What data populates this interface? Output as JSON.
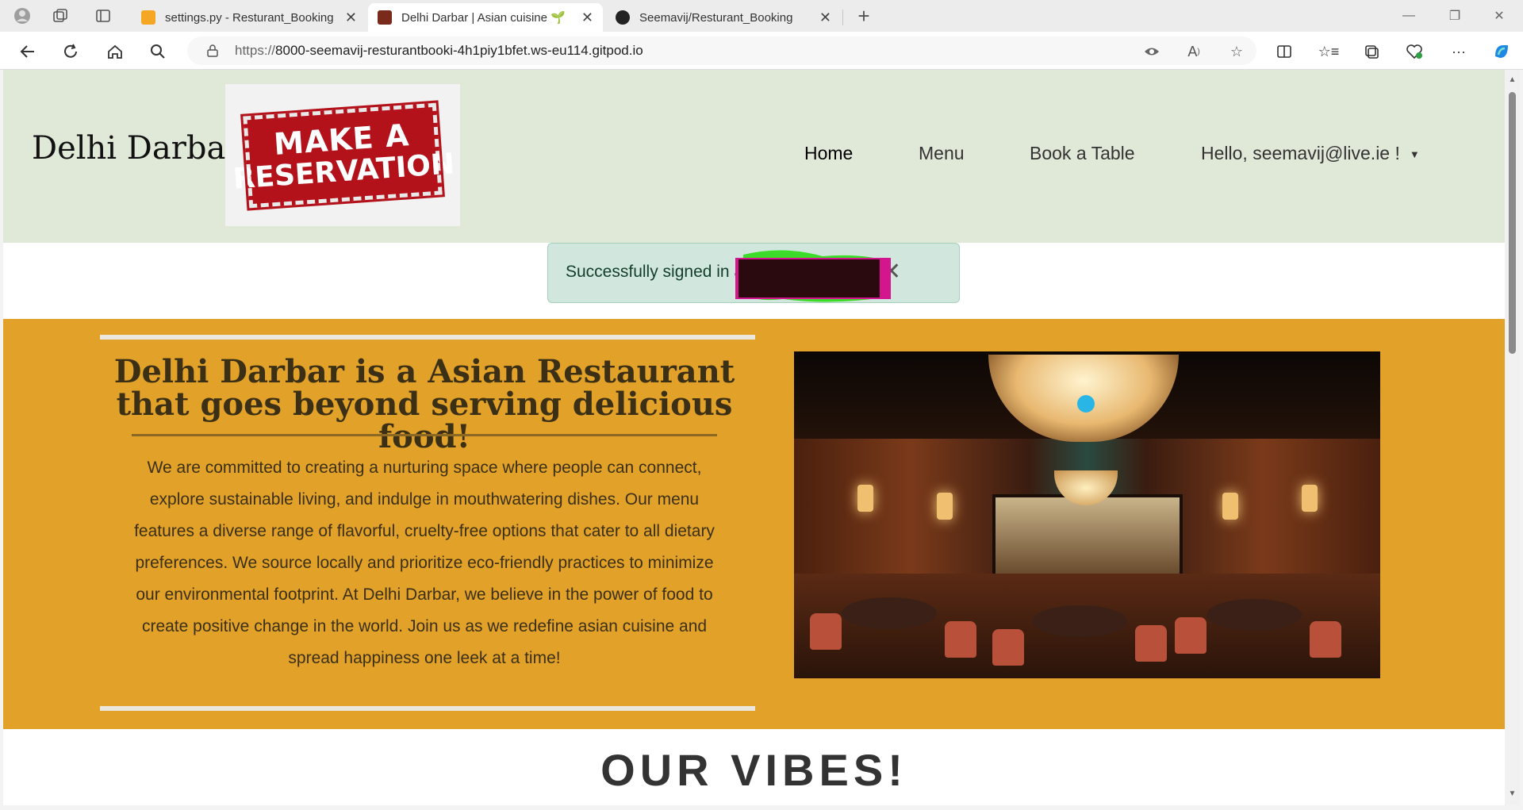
{
  "browser": {
    "tabs": [
      {
        "label": "settings.py - Resturant_Booking",
        "favicon_color": "#f5a623"
      },
      {
        "label": "Delhi Darbar | Asian cuisine 🌱",
        "favicon_color": "#7a2a1a"
      },
      {
        "label": "Seemavij/Resturant_Booking",
        "favicon_color": "#222222"
      }
    ],
    "url": {
      "scheme": "https://",
      "rest": "8000-seemavij-resturantbooki-4h1piy1bfet.ws-eu114.gitpod.io"
    }
  },
  "header": {
    "brand": "Delhi Darbar",
    "logo_lines": [
      "MAKE A",
      "RESERVATION"
    ],
    "nav": {
      "home": "Home",
      "menu": "Menu",
      "book": "Book a Table",
      "account": "Hello, seemavij@live.ie !"
    }
  },
  "alert": {
    "message": "Successfully signed in a",
    "close": "✕"
  },
  "about": {
    "title": "Delhi Darbar is a Asian Restaurant that goes beyond serving delicious food!",
    "body": "We are committed to creating a nurturing space where people can connect, explore sustainable living, and indulge in mouthwatering dishes. Our menu features a diverse range of flavorful, cruelty-free options that cater to all dietary preferences. We source locally and prioritize eco-friendly practices to minimize our environmental footprint. At Delhi Darbar, we believe in the power of food to create positive change in the world. Join us as we redefine asian cuisine and spread happiness one leek at a time!"
  },
  "vibes": {
    "heading": "OUR VIBES!"
  },
  "colors": {
    "header_bg": "#e0e8d8",
    "about_bg": "#e2a128",
    "alert_bg": "#d1e7dd"
  }
}
